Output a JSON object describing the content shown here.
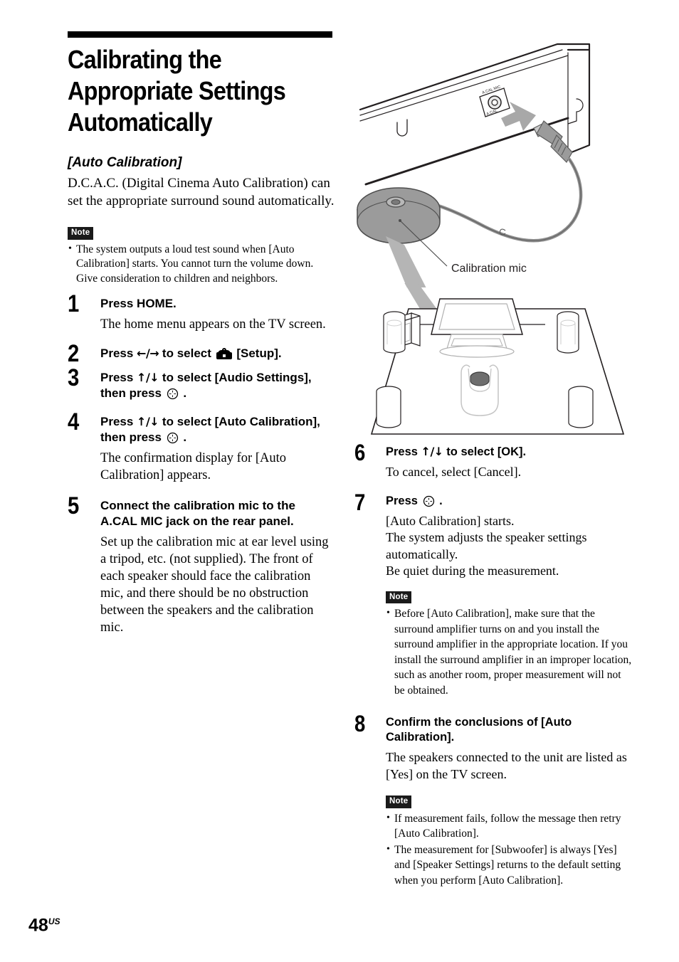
{
  "heading": {
    "title": "Calibrating the Appropriate Settings Automatically",
    "subtitle": "[Auto Calibration]",
    "lead": "D.C.A.C. (Digital Cinema Auto Calibration) can set the appropriate surround sound automatically."
  },
  "notes": {
    "badge_label": "Note",
    "intro": [
      "The system outputs a loud test sound when [Auto Calibration] starts. You cannot turn the volume down. Give consideration to children and neighbors."
    ],
    "after_step7": [
      "Before [Auto Calibration], make sure that the surround amplifier turns on and you install the surround amplifier in the appropriate location. If you install the surround amplifier in an improper location, such as another room, proper measurement will not be obtained."
    ],
    "after_step8": [
      "If measurement fails, follow the message then retry [Auto Calibration].",
      "The measurement for [Subwoofer] is always [Yes] and [Speaker Settings] returns to the default setting when you perform [Auto Calibration]."
    ]
  },
  "steps": {
    "s1": {
      "num": "1",
      "head": "Press HOME.",
      "body": [
        "The home menu appears on the TV screen."
      ]
    },
    "s2": {
      "num": "2",
      "head_pre": "Press ",
      "head_arrows": "←/→",
      "head_mid": " to select ",
      "head_post": " [Setup].",
      "icon": "toolbox-icon"
    },
    "s3": {
      "num": "3",
      "head_pre": "Press ",
      "head_arrows": "↑/↓",
      "head_mid": " to select [Audio Settings],",
      "head_line2_pre": "then press ",
      "head_line2_post": " .",
      "icon": "enter-button-icon"
    },
    "s4": {
      "num": "4",
      "head_pre": "Press ",
      "head_arrows": "↑/↓",
      "head_mid": " to select [Auto Calibration],",
      "head_line2_pre": "then press ",
      "head_line2_post": " .",
      "icon": "enter-button-icon",
      "body": [
        "The confirmation display for [Auto Calibration] appears."
      ]
    },
    "s5": {
      "num": "5",
      "head": "Connect the calibration mic to the A.CAL MIC jack on the rear panel.",
      "body": [
        "Set up the calibration mic at ear level using a tripod, etc. (not supplied). The front of each speaker should face the calibration mic, and there should be no obstruction between the speakers and the calibration mic."
      ]
    },
    "s6": {
      "num": "6",
      "head_pre": "Press ",
      "head_arrows": "↑/↓",
      "head_mid": " to select [OK].",
      "body": [
        "To cancel, select [Cancel]."
      ]
    },
    "s7": {
      "num": "7",
      "head_pre": "Press ",
      "head_post": " .",
      "icon": "enter-button-icon",
      "body": [
        "[Auto Calibration] starts.",
        "The system adjusts the speaker settings automatically.",
        "Be quiet during the measurement."
      ]
    },
    "s8": {
      "num": "8",
      "head": "Confirm the conclusions of [Auto Calibration].",
      "body": [
        "The speakers connected to the unit are listed as [Yes] on the TV screen."
      ]
    }
  },
  "figures": {
    "top": {
      "caption": "Calibration mic",
      "jack_label": "A.CAL MIC",
      "alt": "rear panel of unit with calibration mic plugged into A.CAL MIC jack"
    },
    "room": {
      "alt": "room layout with TV, four speakers, subwoofer and listener seat with calibration mic"
    }
  },
  "folio": {
    "page": "48",
    "region": "US"
  },
  "colors": {
    "ink": "#000000",
    "paper": "#ffffff",
    "note_badge_bg": "#1a1a1a",
    "fig_line": "#231f20",
    "fig_gray": "#9b9b9b",
    "fig_gray_light": "#c9c9c9",
    "fig_gray_dark": "#6e6e6e",
    "arrow_gray": "#a8a8a8"
  }
}
